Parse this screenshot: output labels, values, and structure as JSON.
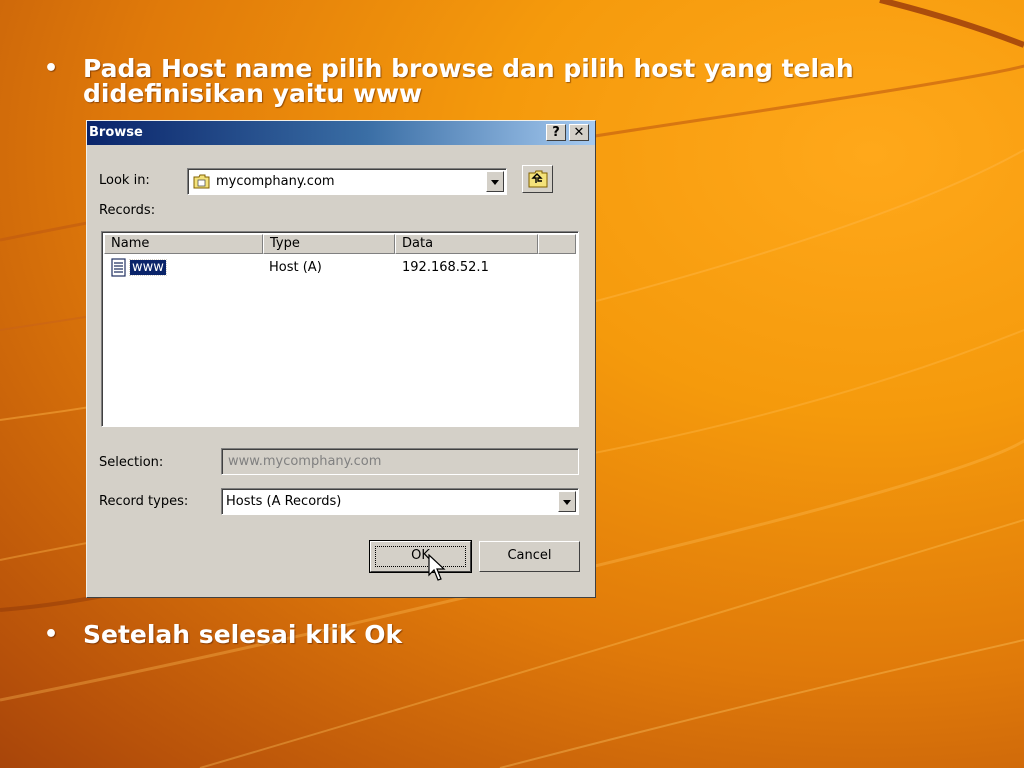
{
  "slide": {
    "bullet1_line1": "Pada Host name pilih browse dan pilih host yang telah",
    "bullet1_line2": "didefinisikan yaitu www",
    "bullet2": "Setelah selesai klik Ok",
    "bullet_glyph": "•"
  },
  "dialog": {
    "title": "Browse",
    "help_label": "?",
    "close_label": "✕",
    "look_in_label": "Look in:",
    "look_in_value": "mycomphany.com",
    "records_label": "Records:",
    "columns": [
      "Name",
      "Type",
      "Data"
    ],
    "records": [
      {
        "name": "www",
        "type": "Host (A)",
        "data": "192.168.52.1"
      }
    ],
    "selection_label": "Selection:",
    "selection_value": "www.mycomphany.com",
    "record_types_label": "Record types:",
    "record_types_value": "Hosts (A Records)",
    "ok_label": "OK",
    "cancel_label": "Cancel"
  },
  "colors": {
    "title_bar": "#0a246a",
    "dialog_face": "#d4d0c8",
    "slide_background": "#f59a0c"
  },
  "icons": [
    "folder-icon",
    "up-folder-icon",
    "record-icon",
    "dropdown-arrow-icon",
    "mouse-cursor-icon"
  ]
}
